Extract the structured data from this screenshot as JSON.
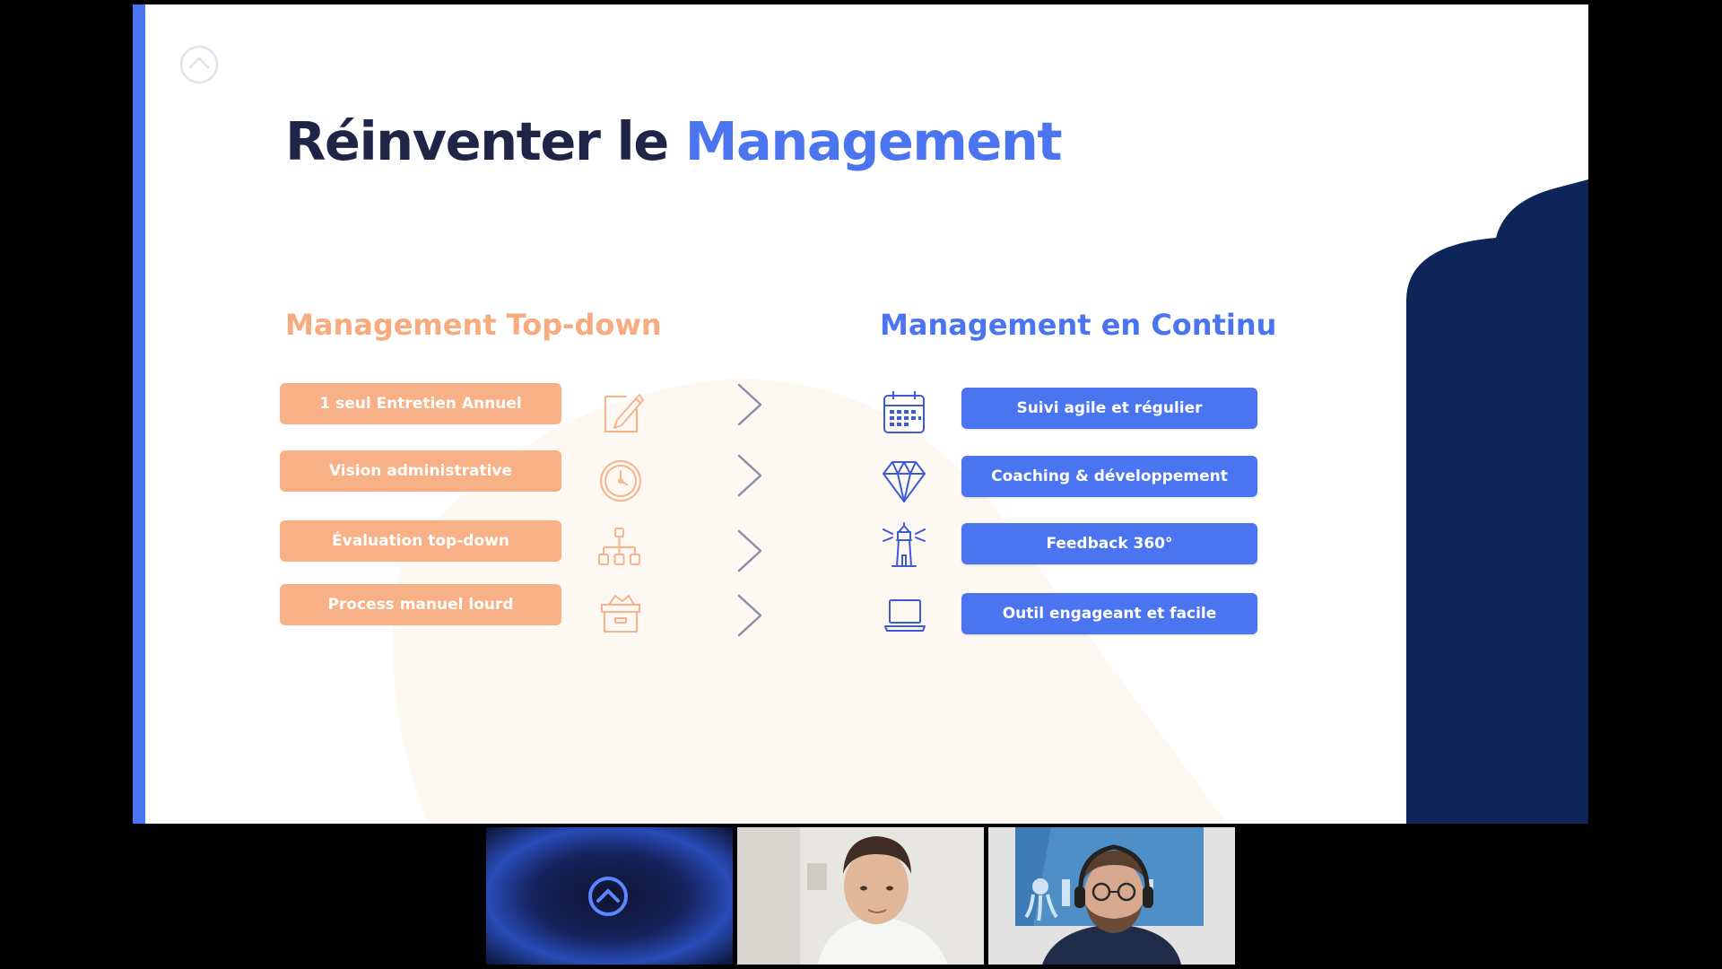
{
  "slide": {
    "title_part1": "Réinventer le ",
    "title_part2": "Management",
    "left_heading": "Management Top-down",
    "right_heading": "Management en Continu",
    "left_items": [
      {
        "label": "1 seul Entretien Annuel",
        "icon": "pencil-note-icon"
      },
      {
        "label": "Vision administrative",
        "icon": "clock-icon"
      },
      {
        "label": "Évaluation top-down",
        "icon": "org-chart-icon"
      },
      {
        "label": "Process manuel lourd",
        "icon": "archive-box-icon"
      }
    ],
    "right_items": [
      {
        "label": "Suivi agile et régulier",
        "icon": "calendar-icon"
      },
      {
        "label": "Coaching & développement",
        "icon": "diamond-icon"
      },
      {
        "label": "Feedback 360°",
        "icon": "lighthouse-icon"
      },
      {
        "label": "Outil engageant et facile",
        "icon": "laptop-icon"
      }
    ]
  },
  "colors": {
    "accent_blue": "#4b74f0",
    "accent_orange": "#f8b086",
    "title_dark": "#1f2547",
    "navy_shape": "#0d2559"
  },
  "participants": [
    {
      "icon": "logo-icon"
    },
    {
      "icon": "camera-video"
    },
    {
      "icon": "camera-video"
    }
  ]
}
